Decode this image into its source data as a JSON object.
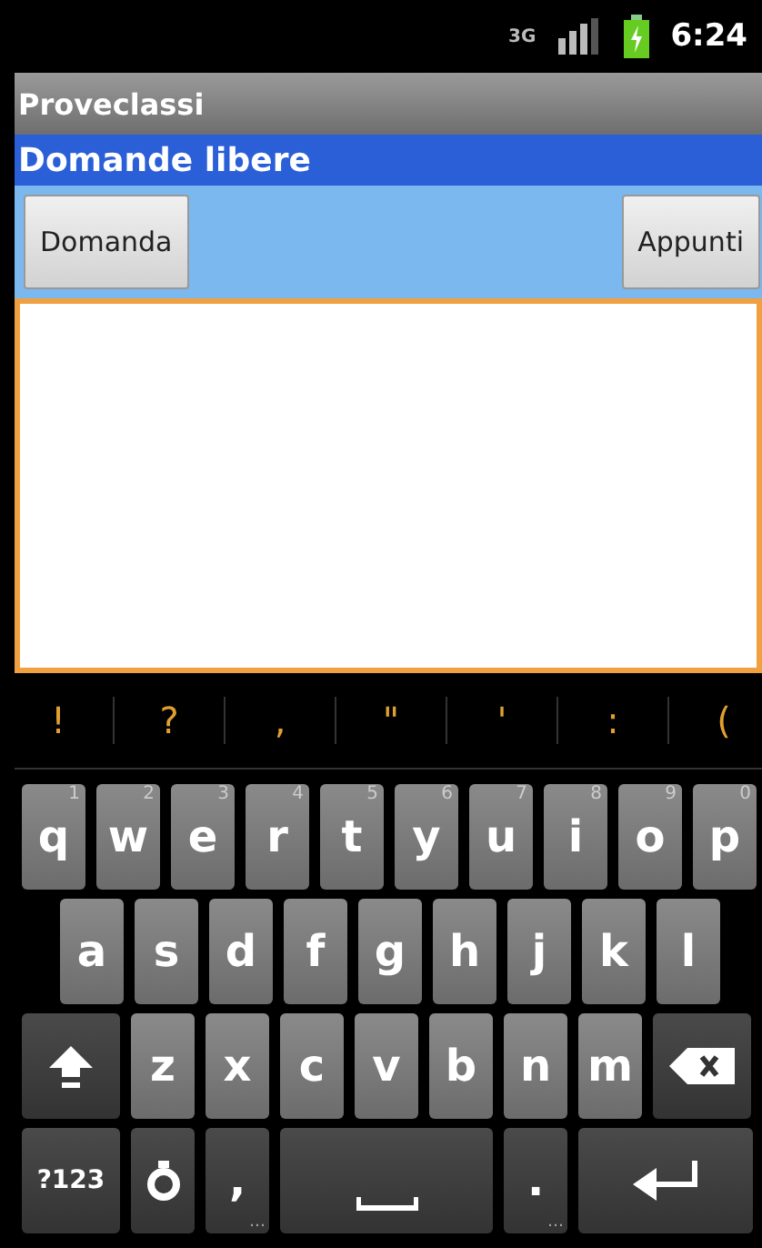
{
  "status_bar": {
    "network": "3G",
    "time": "6:24"
  },
  "app_title": "Proveclassi",
  "header": "Domande libere",
  "buttons": [
    {
      "label": "Domanda"
    },
    {
      "label": "Appunti"
    }
  ],
  "text_area": {
    "focused": true
  },
  "suggestions": [
    "!",
    "?",
    ",",
    "\"",
    "'",
    ":",
    "("
  ],
  "keyboard": {
    "rows": [
      {
        "keys": [
          {
            "kind": "letter",
            "label": "q",
            "hint": "1"
          },
          {
            "kind": "letter",
            "label": "w",
            "hint": "2"
          },
          {
            "kind": "letter",
            "label": "e",
            "hint": "3"
          },
          {
            "kind": "letter",
            "label": "r",
            "hint": "4"
          },
          {
            "kind": "letter",
            "label": "t",
            "hint": "5"
          },
          {
            "kind": "letter",
            "label": "y",
            "hint": "6"
          },
          {
            "kind": "letter",
            "label": "u",
            "hint": "7"
          },
          {
            "kind": "letter",
            "label": "i",
            "hint": "8"
          },
          {
            "kind": "letter",
            "label": "o",
            "hint": "9"
          },
          {
            "kind": "letter",
            "label": "p",
            "hint": "0"
          }
        ]
      },
      {
        "keys": [
          {
            "kind": "letter",
            "label": "a"
          },
          {
            "kind": "letter",
            "label": "s"
          },
          {
            "kind": "letter",
            "label": "d"
          },
          {
            "kind": "letter",
            "label": "f"
          },
          {
            "kind": "letter",
            "label": "g"
          },
          {
            "kind": "letter",
            "label": "h"
          },
          {
            "kind": "letter",
            "label": "j"
          },
          {
            "kind": "letter",
            "label": "k"
          },
          {
            "kind": "letter",
            "label": "l"
          }
        ]
      },
      {
        "keys": [
          {
            "kind": "shift"
          },
          {
            "kind": "letter",
            "label": "z"
          },
          {
            "kind": "letter",
            "label": "x"
          },
          {
            "kind": "letter",
            "label": "c"
          },
          {
            "kind": "letter",
            "label": "v"
          },
          {
            "kind": "letter",
            "label": "b"
          },
          {
            "kind": "letter",
            "label": "n"
          },
          {
            "kind": "letter",
            "label": "m"
          },
          {
            "kind": "delete"
          }
        ]
      },
      {
        "keys": [
          {
            "kind": "symbols",
            "label": "?123"
          },
          {
            "kind": "settings"
          },
          {
            "kind": "punct",
            "label": ",",
            "hint": "…"
          },
          {
            "kind": "space"
          },
          {
            "kind": "punct",
            "label": ".",
            "hint": "…"
          },
          {
            "kind": "enter"
          }
        ]
      }
    ]
  }
}
